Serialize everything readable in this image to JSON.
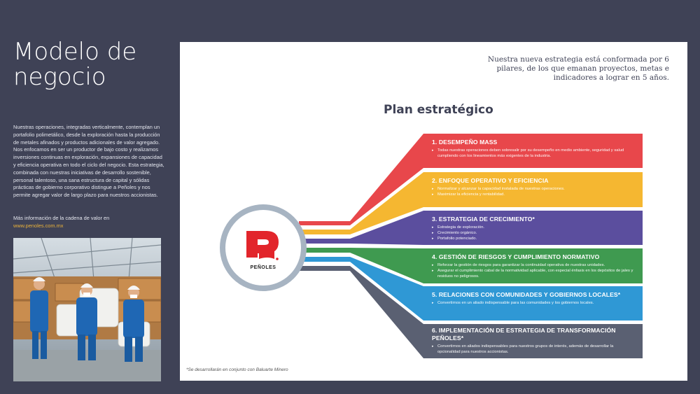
{
  "page": {
    "title_line1": "Modelo de",
    "title_line2": "negocio",
    "intro": "Nuestras operaciones, integradas verticalmente, contemplan un portafolio polimetálico, desde la exploración hasta la producción de metales afinados y productos adicionales de valor agregado. Nos enfocamos en ser un productor de bajo costo y realizamos inversiones continuas en exploración, expansiones de capacidad y eficiencia operativa en todo el ciclo del negocio. Esta estrategia, combinada con nuestras iniciativas de desarrollo sostenible, personal talentoso, una sana estructura de capital y sólidas prácticas de gobierno corporativo distingue a Peñoles y nos permite agregar valor de largo plazo para nuestros accionistas.",
    "more_label": "Más información de la cadena de valor en",
    "more_link": "www.penoles.com.mx"
  },
  "card": {
    "quote": "Nuestra nueva estrategia está conformada por 6 pilares, de los que emanan proyectos, metas e indicadores a lograr en 5 años.",
    "plan_title": "Plan estratégico",
    "footnote": "*Se desarrollarán en conjunto con Baluarte Minero",
    "logo_text": "PEÑOLES"
  },
  "pillars": [
    {
      "title": "1. DESEMPEÑO MASS",
      "color": "#e8474b",
      "items": [
        "Todas nuestras operaciones deben sobresalir por su desempeño en medio ambiente, seguridad y salud cumpliendo con los lineamientos más exigentes de la industria."
      ]
    },
    {
      "title": "2. ENFOQUE OPERATIVO Y EFICIENCIA",
      "color": "#f5b731",
      "items": [
        "Normalizar y alcanzar la capacidad instalada de nuestras operaciones.",
        "Maximizar la eficiencia y rentabilidad."
      ]
    },
    {
      "title": "3. ESTRATEGIA DE CRECIMIENTO*",
      "color": "#5b4e9e",
      "items": [
        "Estrategia de exploración.",
        "Crecimiento orgánico.",
        "Portafolio potenciado."
      ]
    },
    {
      "title": "4. GESTIÓN DE RIESGOS Y CUMPLIMIENTO NORMATIVO",
      "color": "#3f9a50",
      "items": [
        "Reforzar la gestión de riesgos para garantizar la continuidad operativa de nuestras unidades.",
        "Asegurar el cumplimiento cabal de la normatividad aplicable, con especial énfasis en los depósitos de jales y residuos no peligrosos."
      ]
    },
    {
      "title": "5. RELACIONES CON COMUNIDADES Y GOBIERNOS LOCALES*",
      "color": "#2f98d5",
      "items": [
        "Convertirnos en un aliado indispensable para las comunidades y los gobiernos locales."
      ]
    },
    {
      "title": "6. IMPLEMENTACIÓN DE ESTRATEGIA DE TRANSFORMACIÓN PEÑOLES*",
      "color": "#5a6072",
      "items": [
        "Convertirnos en aliados indispensables para nuestros grupos de interés, además de desarrollar la opcionalidad para nuestros accionistas."
      ]
    }
  ]
}
